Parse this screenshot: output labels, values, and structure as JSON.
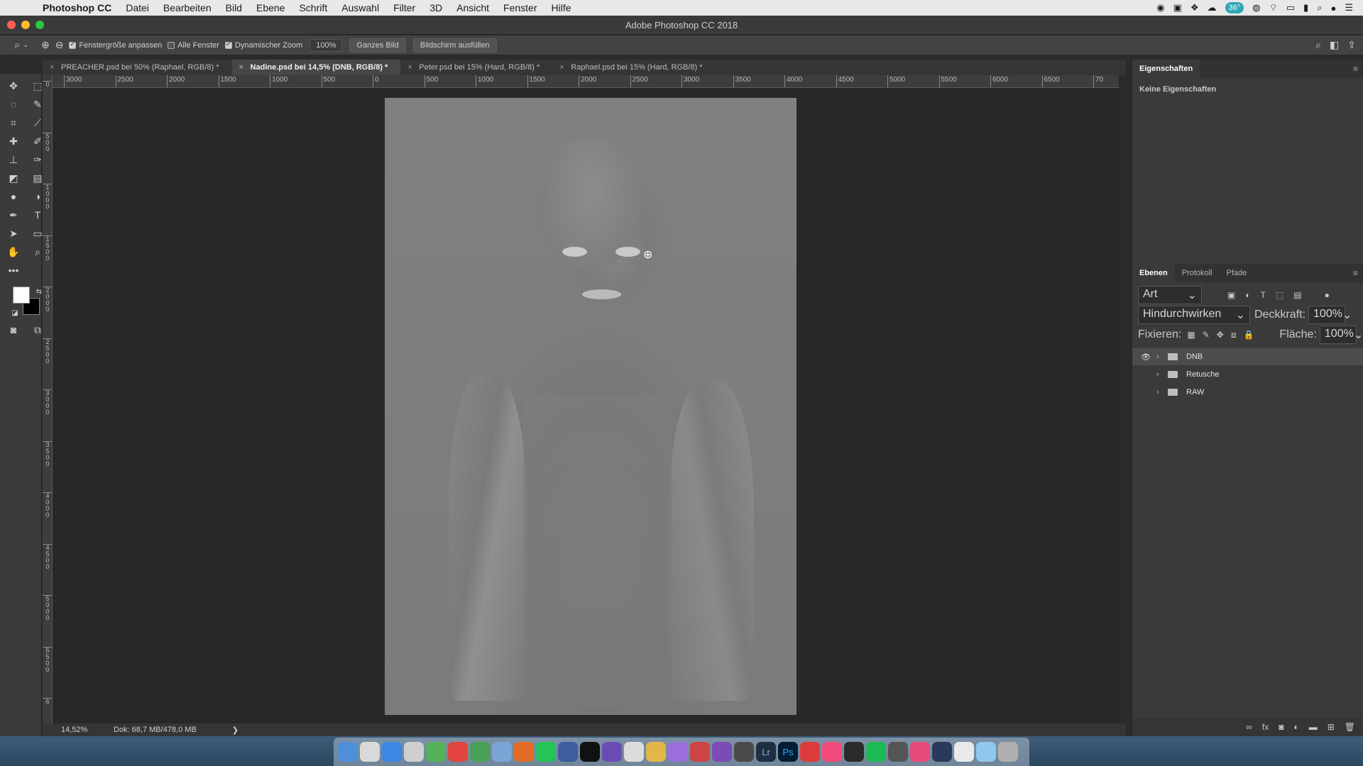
{
  "menubar": {
    "app_name": "Photoshop CC",
    "items": [
      "Datei",
      "Bearbeiten",
      "Bild",
      "Ebene",
      "Schrift",
      "Auswahl",
      "Filter",
      "3D",
      "Ansicht",
      "Fenster",
      "Hilfe"
    ],
    "badge": "36°"
  },
  "window": {
    "title": "Adobe Photoshop CC 2018"
  },
  "options": {
    "resize_windows_label": "Fenstergröße anpassen",
    "all_windows_label": "Alle Fenster",
    "scrubby_zoom_label": "Dynamischer Zoom",
    "zoom_value": "100%",
    "fit_screen_label": "Ganzes Bild",
    "fill_screen_label": "Bildschirm ausfüllen"
  },
  "tabs": [
    {
      "label": "PREACHER.psd bei 50% (Raphael, RGB/8) *",
      "active": false
    },
    {
      "label": "Nadine.psd bei 14,5% (DNB, RGB/8) *",
      "active": true
    },
    {
      "label": "Peter.psd bei 15% (Hard, RGB/8) *",
      "active": false
    },
    {
      "label": "Raphael.psd bei 15% (Hard, RGB/8) *",
      "active": false
    }
  ],
  "ruler_h": [
    "3000",
    "2500",
    "2000",
    "1500",
    "1000",
    "500",
    "0",
    "500",
    "1000",
    "1500",
    "2000",
    "2500",
    "3000",
    "3500",
    "4000",
    "4500",
    "5000",
    "5500",
    "6000",
    "6500",
    "70"
  ],
  "ruler_v": [
    "0",
    "5 0 0",
    "1 0 0 0",
    "1 5 0 0",
    "2 0 0 0",
    "2 5 0 0",
    "3 0 0 0",
    "3 5 0 0",
    "4 0 0 0",
    "4 5 0 0",
    "5 0 0 0",
    "5 5 0 0",
    "6"
  ],
  "status": {
    "zoom": "14,52%",
    "doc": "Dok: 68,7 MB/478,0 MB",
    "arrow": "❯"
  },
  "properties": {
    "tab": "Eigenschaften",
    "empty": "Keine Eigenschaften"
  },
  "layers": {
    "tabs": [
      "Ebenen",
      "Protokoll",
      "Pfade"
    ],
    "filter_kind": "Art",
    "blend_mode": "Hindurchwirken",
    "opacity_label": "Deckkraft:",
    "opacity_value": "100%",
    "lock_label": "Fixieren:",
    "fill_label": "Fläche:",
    "fill_value": "100%",
    "items": [
      {
        "name": "DNB",
        "visible": true,
        "selected": true
      },
      {
        "name": "Retusche",
        "visible": false,
        "selected": false
      },
      {
        "name": "RAW",
        "visible": false,
        "selected": false
      }
    ],
    "footer_fx": "fx"
  },
  "icons": {
    "zoom_tool": "magnifier-icon",
    "zoom_in": "zoom-in-icon",
    "zoom_out": "zoom-out-icon"
  },
  "dock": {
    "icon_labels": {
      "lr": "Lr",
      "ps": "Ps"
    },
    "colors": [
      "#4f8fd9",
      "#d9d9d9",
      "#3d86e3",
      "#cfcfcf",
      "#56b15b",
      "#e0443c",
      "#4a9f58",
      "#7aa5d6",
      "#e36b26",
      "#25c35a",
      "#3d5d9d",
      "#111111",
      "#6a4bb3",
      "#dcdcdc",
      "#e3b64a",
      "#9b6fdb",
      "#c44",
      "#7d4bb5",
      "#4a4a4a",
      "#1f2f3f",
      "#001d34",
      "#dc3b39",
      "#f24b7b",
      "#2a2a2a",
      "#1db954",
      "#555555",
      "#e64a7a",
      "#2a3a5a",
      "#e9e9e9",
      "#8ec7ef",
      "#b0b0b0"
    ]
  }
}
